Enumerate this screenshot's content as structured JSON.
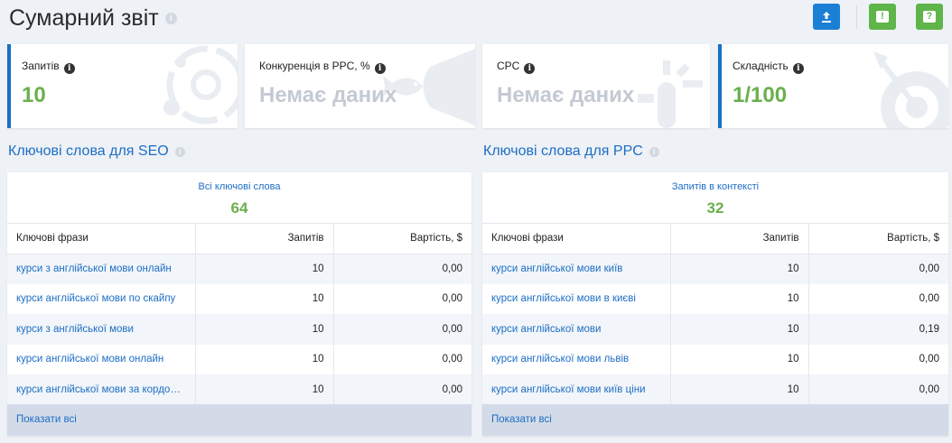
{
  "header": {
    "title": "Сумарний звіт"
  },
  "icons": {
    "info": "i",
    "export": "upload-icon",
    "feedback": "!",
    "help": "?"
  },
  "cards": [
    {
      "label": "Запитів",
      "value": "10"
    },
    {
      "label": "Конкуренція в PPC, %",
      "value": "Немає даних"
    },
    {
      "label": "CPC",
      "value": "Немає даних"
    },
    {
      "label": "Складність",
      "value": "1/100"
    }
  ],
  "seo": {
    "title": "Ключові слова для SEO",
    "summary_label": "Всі ключові слова",
    "summary_value": "64",
    "columns": [
      "Ключові фрази",
      "Запитів",
      "Вартість, $"
    ],
    "rows": [
      [
        "курси з англійської мови онлайн",
        "10",
        "0,00"
      ],
      [
        "курси англійської мови по скайпу",
        "10",
        "0,00"
      ],
      [
        "курси з англійської мови",
        "10",
        "0,00"
      ],
      [
        "курси англійської мови онлайн",
        "10",
        "0,00"
      ],
      [
        "курси англійської мови за кордоном",
        "10",
        "0,00"
      ]
    ],
    "show_all": "Показати всі"
  },
  "ppc": {
    "title": "Ключові слова для PPC",
    "summary_label": "Запитів в контексті",
    "summary_value": "32",
    "columns": [
      "Ключові фрази",
      "Запитів",
      "Вартість, $"
    ],
    "rows": [
      [
        "курси англійської мови київ",
        "10",
        "0,00"
      ],
      [
        "курси англійської мови в києві",
        "10",
        "0,00"
      ],
      [
        "курси англійської мови",
        "10",
        "0,19"
      ],
      [
        "курси англійської мови львів",
        "10",
        "0,00"
      ],
      [
        "курси англійської мови київ ціни",
        "10",
        "0,00"
      ]
    ],
    "show_all": "Показати всі"
  },
  "colors": {
    "accent": "#1d6ec5",
    "green": "#6ab04c",
    "card_border": "#1a6fc4"
  }
}
